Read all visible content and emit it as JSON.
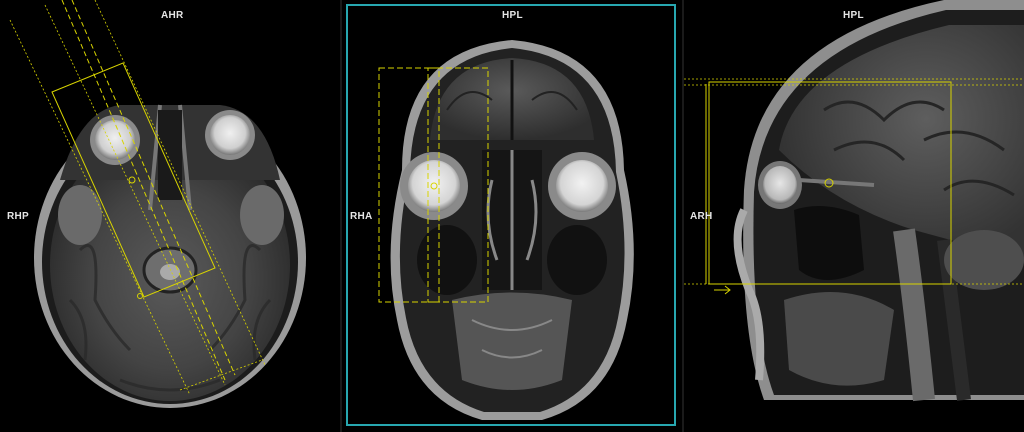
{
  "viewports": {
    "axial": {
      "orientation_top": "AHR",
      "orientation_left": "RHP",
      "active": false
    },
    "coronal": {
      "orientation_top": "HPL",
      "orientation_left": "RHA",
      "active": true
    },
    "sagittal": {
      "orientation_top": "HPL",
      "orientation_left": "ARH",
      "active": false
    }
  },
  "colors": {
    "planning_overlay": "#d8d400",
    "active_frame": "#27a7b0",
    "orientation_text": "#e6e6e6"
  }
}
